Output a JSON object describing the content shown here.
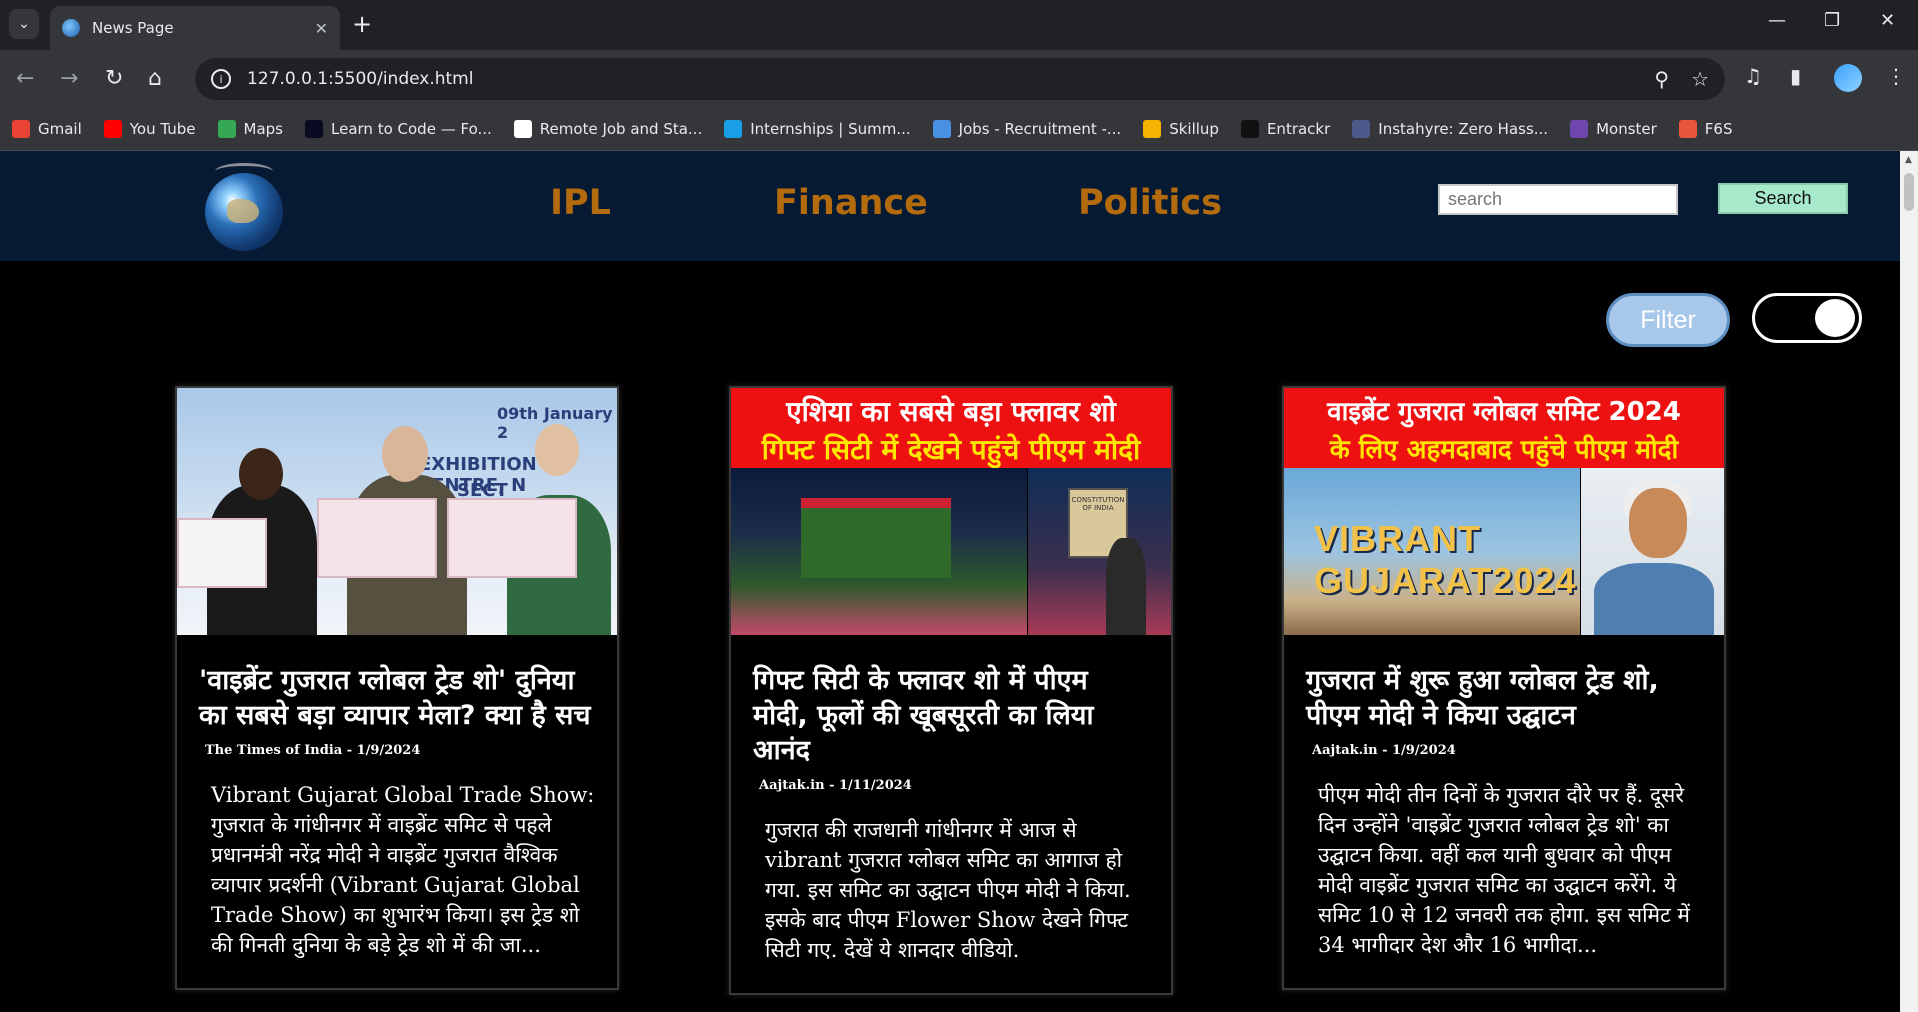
{
  "browser": {
    "tab_title": "News Page",
    "url": "127.0.0.1:5500/index.html",
    "bookmarks": [
      {
        "label": "Gmail",
        "icon": "gmail-icon",
        "color": "#ea4335"
      },
      {
        "label": "You Tube",
        "icon": "youtube-icon",
        "color": "#ff0000"
      },
      {
        "label": "Maps",
        "icon": "maps-icon",
        "color": "#34a853"
      },
      {
        "label": "Learn to Code — Fo...",
        "icon": "freecodecamp-icon",
        "color": "#0a0a23"
      },
      {
        "label": "Remote Job and Sta...",
        "icon": "wellfound-icon",
        "color": "#ffffff"
      },
      {
        "label": "Internships | Summ...",
        "icon": "internshala-icon",
        "color": "#1a9ee6"
      },
      {
        "label": "Jobs - Recruitment -...",
        "icon": "naukri-icon",
        "color": "#4a90e2"
      },
      {
        "label": "Skillup",
        "icon": "skillup-icon",
        "color": "#f5b400"
      },
      {
        "label": "Entrackr",
        "icon": "entrackr-icon",
        "color": "#111111"
      },
      {
        "label": "Instahyre: Zero Hass...",
        "icon": "instahyre-icon",
        "color": "#4b5a8a"
      },
      {
        "label": "Monster",
        "icon": "monster-icon",
        "color": "#6e46ae"
      },
      {
        "label": "F6S",
        "icon": "f6s-icon",
        "color": "#e8553b"
      }
    ]
  },
  "site": {
    "nav": [
      "IPL",
      "Finance",
      "Politics"
    ],
    "search_placeholder": "search",
    "search_button": "Search",
    "filter_button": "Filter",
    "nav_color": "#b36b0e",
    "header_bg": "#071a33"
  },
  "cards": [
    {
      "title": "'वाइब्रेंट गुजरात ग्लोबल ट्रेड शो' दुनिया का सबसे बड़ा व्यापार मेला? क्या है सच",
      "source": "The Times of India - 1/9/2024",
      "body": "Vibrant Gujarat Global Trade Show: गुजरात के गांधीनगर में वाइब्रेंट समिट से पहले प्रधानमंत्री नरेंद्र मोदी ने वाइब्रेंट गुजरात वैश्विक व्यापार प्रदर्शनी (Vibrant Gujarat Global Trade Show) का शुभारंभ किया। इस ट्रेड शो की गिनती दुनिया के बड़े ट्रेड शो में की जा...",
      "image": {
        "banner_line1": "09th January 2",
        "banner_line2": "EXHIBITION CENTRE, N",
        "banner_line3": "SECT"
      }
    },
    {
      "title": "गिफ्ट सिटी के फ्लावर शो में पीएम मोदी, फूलों की खूबसूरती का लिया आनंद",
      "source": "Aajtak.in - 1/11/2024",
      "body": "गुजरात की राजधानी गांधीनगर में आज से vibrant गुजरात ग्लोबल समिट का आगाज हो गया. इस समिट का उद्घाटन पीएम मोदी ने किया. इसके बाद पीएम Flower Show देखने गिफ्ट सिटी गए. देखें ये शानदार वीडियो.",
      "image": {
        "headline1": "एशिया का सबसे बड़ा फ्लावर शो",
        "headline2": "गिफ्ट सिटी में देखने पहुंचे पीएम मोदी",
        "sign": "CONSTITUTION OF INDIA"
      }
    },
    {
      "title": "गुजरात में शुरू हुआ ग्लोबल ट्रेड शो, पीएम मोदी ने किया उद्घाटन",
      "source": "Aajtak.in - 1/9/2024",
      "body": "पीएम मोदी तीन दिनों के गुजरात दौरे पर हैं. दूसरे दिन उन्होंने 'वाइब्रेंट गुजरात ग्लोबल ट्रेड शो' का उद्घाटन किया. वहीं कल यानी बुधवार को पीएम मोदी वाइब्रेंट गुजरात समिट का उद्घाटन करेंगे. ये समिट 10 से 12 जनवरी तक होगा. इस समिट में 34 भागीदार देश और 16 भागीदा...",
      "image": {
        "headline1": "वाइब्रेंट गुजरात ग्लोबल समिट 2024",
        "headline2": "के लिए अहमदाबाद पहुंचे पीएम मोदी",
        "logo_text": "VIBRANT GUJARAT2024"
      }
    }
  ]
}
